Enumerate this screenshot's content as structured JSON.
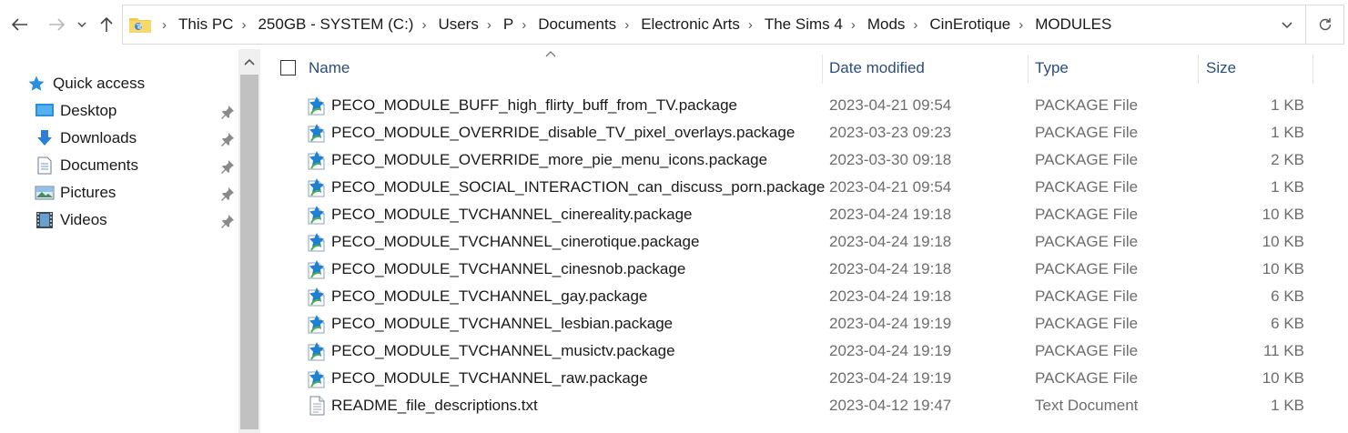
{
  "address": {
    "path": [
      "This PC",
      "250GB - SYSTEM (C:)",
      "Users",
      "P",
      "Documents",
      "Electronic Arts",
      "The Sims 4",
      "Mods",
      "CinErotique",
      "MODULES"
    ]
  },
  "nav": {
    "quick_access": "Quick access",
    "items": [
      {
        "label": "Desktop",
        "icon": "desktop-icon"
      },
      {
        "label": "Downloads",
        "icon": "downloads-icon"
      },
      {
        "label": "Documents",
        "icon": "documents-icon"
      },
      {
        "label": "Pictures",
        "icon": "pictures-icon"
      },
      {
        "label": "Videos",
        "icon": "videos-icon"
      }
    ]
  },
  "columns": {
    "name": "Name",
    "date": "Date modified",
    "type": "Type",
    "size": "Size"
  },
  "files": [
    {
      "name": "PECO_MODULE_BUFF_high_flirty_buff_from_TV.package",
      "date": "2023-04-21 09:54",
      "type": "PACKAGE File",
      "size": "1 KB",
      "icon": "package-icon"
    },
    {
      "name": "PECO_MODULE_OVERRIDE_disable_TV_pixel_overlays.package",
      "date": "2023-03-23 09:23",
      "type": "PACKAGE File",
      "size": "1 KB",
      "icon": "package-icon"
    },
    {
      "name": "PECO_MODULE_OVERRIDE_more_pie_menu_icons.package",
      "date": "2023-03-30 09:18",
      "type": "PACKAGE File",
      "size": "2 KB",
      "icon": "package-icon"
    },
    {
      "name": "PECO_MODULE_SOCIAL_INTERACTION_can_discuss_porn.package",
      "date": "2023-04-21 09:54",
      "type": "PACKAGE File",
      "size": "1 KB",
      "icon": "package-icon"
    },
    {
      "name": "PECO_MODULE_TVCHANNEL_cinereality.package",
      "date": "2023-04-24 19:18",
      "type": "PACKAGE File",
      "size": "10 KB",
      "icon": "package-icon"
    },
    {
      "name": "PECO_MODULE_TVCHANNEL_cinerotique.package",
      "date": "2023-04-24 19:18",
      "type": "PACKAGE File",
      "size": "10 KB",
      "icon": "package-icon"
    },
    {
      "name": "PECO_MODULE_TVCHANNEL_cinesnob.package",
      "date": "2023-04-24 19:18",
      "type": "PACKAGE File",
      "size": "10 KB",
      "icon": "package-icon"
    },
    {
      "name": "PECO_MODULE_TVCHANNEL_gay.package",
      "date": "2023-04-24 19:18",
      "type": "PACKAGE File",
      "size": "6 KB",
      "icon": "package-icon"
    },
    {
      "name": "PECO_MODULE_TVCHANNEL_lesbian.package",
      "date": "2023-04-24 19:19",
      "type": "PACKAGE File",
      "size": "6 KB",
      "icon": "package-icon"
    },
    {
      "name": "PECO_MODULE_TVCHANNEL_musictv.package",
      "date": "2023-04-24 19:19",
      "type": "PACKAGE File",
      "size": "11 KB",
      "icon": "package-icon"
    },
    {
      "name": "PECO_MODULE_TVCHANNEL_raw.package",
      "date": "2023-04-24 19:19",
      "type": "PACKAGE File",
      "size": "10 KB",
      "icon": "package-icon"
    },
    {
      "name": "README_file_descriptions.txt",
      "date": "2023-04-12 19:47",
      "type": "Text Document",
      "size": "1 KB",
      "icon": "text-file-icon"
    }
  ],
  "colors": {
    "header_text": "#2b4d7a",
    "secondary_text": "#6d6d6d",
    "quick_access_star": "#2b8fe0"
  }
}
